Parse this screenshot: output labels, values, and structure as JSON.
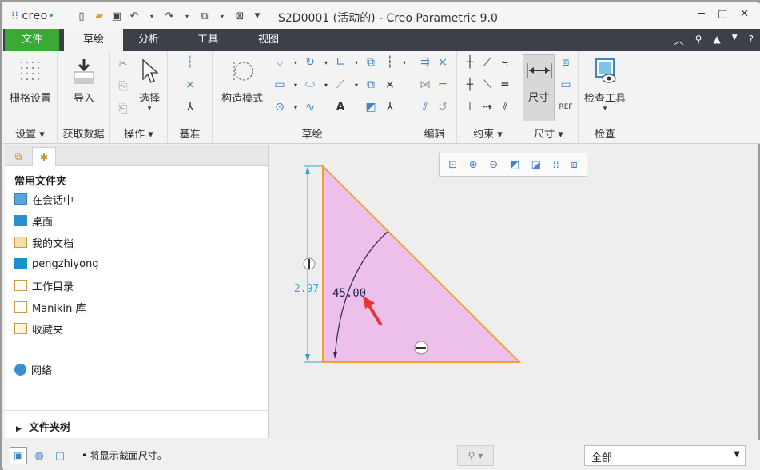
{
  "app": {
    "logo": "creo",
    "title": "S2D0001 (活动的) - Creo Parametric 9.0"
  },
  "menu": {
    "tabs": [
      "文件",
      "草绘",
      "分析",
      "工具",
      "视图"
    ]
  },
  "ribbon": {
    "grid_settings": "栅格设置",
    "import": "导入",
    "select": "选择",
    "construction_mode": "构造模式",
    "dimension": "尺寸",
    "inspection_tools": "检查工具",
    "groups": {
      "setup": "设置",
      "get_data": "获取数据",
      "operations": "操作",
      "datum": "基准",
      "sketch": "草绘",
      "edit": "编辑",
      "constrain": "约束",
      "dimension": "尺寸",
      "inspect": "检查"
    }
  },
  "left_pane": {
    "favorites_title": "常用文件夹",
    "items": [
      {
        "label": "在会话中",
        "icon": "monitor-icon"
      },
      {
        "label": "桌面",
        "icon": "desktop-icon"
      },
      {
        "label": "我的文档",
        "icon": "documents-icon"
      },
      {
        "label": "pengzhiyong",
        "icon": "user-computer-icon"
      },
      {
        "label": "工作目录",
        "icon": "working-dir-icon"
      },
      {
        "label": "Manikin 库",
        "icon": "library-icon"
      },
      {
        "label": "收藏夹",
        "icon": "favorites-icon"
      }
    ],
    "network": "网络",
    "folder_tree": "文件夹树"
  },
  "sketch": {
    "angle_dim": "45.00",
    "vertical_dim": "2.97",
    "fill_color": "#ecc0ea",
    "edge_color": "#f0a030",
    "dim_color": "#2ea8c8",
    "arrow_color": "#e53535"
  },
  "status": {
    "message": "将显示截面尺寸。",
    "filter": "全部"
  },
  "colors": {
    "accent": "#3aa935",
    "tabbar": "#3d4046"
  }
}
